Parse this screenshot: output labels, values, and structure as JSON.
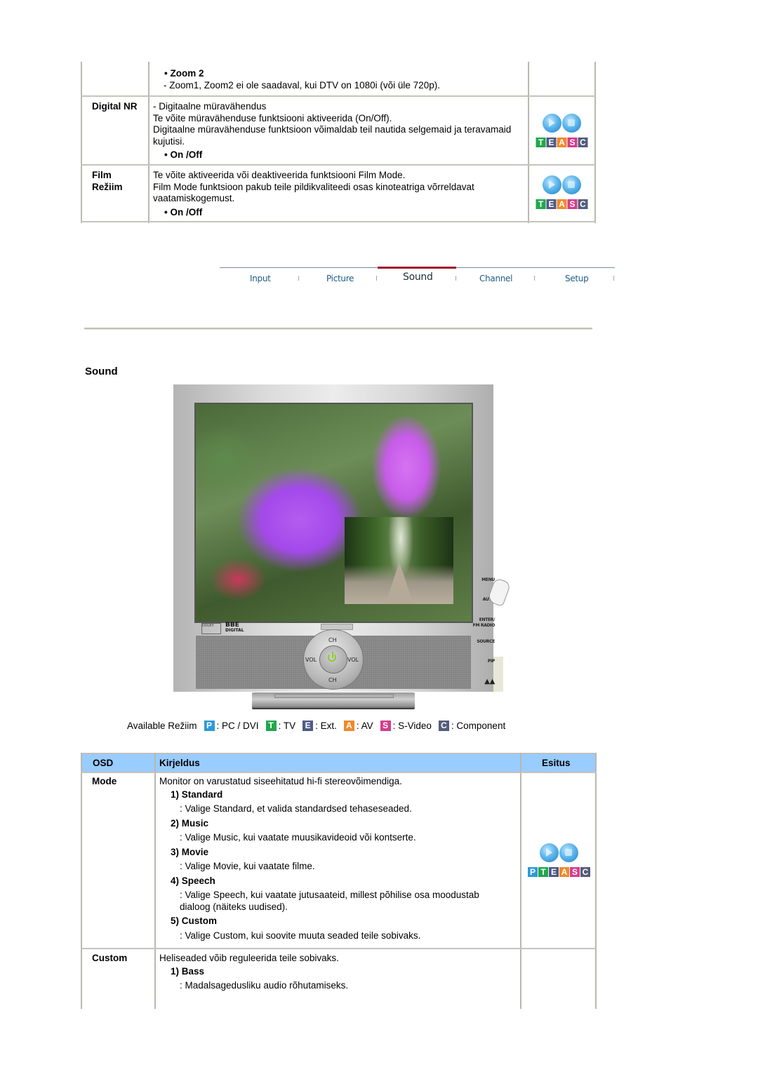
{
  "top_table": {
    "zoom_row": {
      "bullet": "• Zoom 2",
      "note": "- Zoom1, Zoom2 ei ole saadaval, kui DTV on 1080i (või üle 720p)."
    },
    "rows": [
      {
        "label": "Digital NR",
        "lines": [
          "- Digitaalne müravähendus",
          "Te võite müravähenduse funktsiooni aktiveerida (On/Off).",
          "Digitaalne müravähenduse funktsioon võimaldab teil nautida selgemaid ja teravamaid kujutisi."
        ],
        "bullet": "• On /Off",
        "modes": [
          "T",
          "E",
          "A",
          "S",
          "C"
        ]
      },
      {
        "label_line1": "Film",
        "label_line2": "Režiim",
        "lines": [
          "Te võite aktiveerida või deaktiveerida funktsiooni Film Mode.",
          "Film Mode funktsioon pakub teile pildikvaliteedi osas kinoteatriga võrreldavat vaatamiskogemust."
        ],
        "bullet": "• On /Off",
        "modes": [
          "T",
          "E",
          "A",
          "S",
          "C"
        ]
      }
    ]
  },
  "nav": {
    "items": [
      "Input",
      "Picture",
      "Sound",
      "Channel",
      "Setup"
    ],
    "active": "Sound",
    "active_color": "#a0102a"
  },
  "section_title": "Sound",
  "monitor": {
    "side_buttons": [
      "MENU",
      "AUTO",
      "ENTER/",
      "FM RADIO",
      "SOURCE",
      "PIP"
    ],
    "dpad": {
      "up": "CH",
      "down": "CH",
      "left": "VOL",
      "right": "VOL",
      "left_sign": "−",
      "right_sign": "+"
    },
    "logos": {
      "bbe_top": "BBE",
      "bbe_bottom": "DIGITAL",
      "dolby": "DOLBY"
    }
  },
  "available": {
    "label": "Available Režiim",
    "modes": [
      {
        "letter": "P",
        "text": ": PC / DVI",
        "color": "#2f9ad6"
      },
      {
        "letter": "T",
        "text": ": TV",
        "color": "#22a74e"
      },
      {
        "letter": "E",
        "text": ": Ext.",
        "color": "#4f5a86"
      },
      {
        "letter": "A",
        "text": ": AV",
        "color": "#f08a2c"
      },
      {
        "letter": "S",
        "text": ": S-Video",
        "color": "#d63d8c"
      },
      {
        "letter": "C",
        "text": ": Component",
        "color": "#555c7c"
      }
    ]
  },
  "sound_table": {
    "header": {
      "osd": "OSD",
      "desc": "Kirjeldus",
      "esitus": "Esitus",
      "bg": "#99ccff"
    },
    "mode_row": {
      "label": "Mode",
      "intro": "Monitor on varustatud siseehitatud hi-fi stereovõimendiga.",
      "items": [
        {
          "title": "1) Standard",
          "desc": ": Valige Standard, et valida standardsed tehaseseaded."
        },
        {
          "title": "2) Music",
          "desc": ": Valige Music, kui vaatate muusikavideoid või kontserte."
        },
        {
          "title": "3) Movie",
          "desc": ": Valige Movie, kui vaatate filme."
        },
        {
          "title": "4) Speech",
          "desc": ": Valige Speech, kui vaatate jutusaateid, millest põhilise osa moodustab",
          "desc2": "dialoog (näiteks uudised)."
        },
        {
          "title": "5) Custom",
          "desc": ": Valige Custom, kui soovite muuta seaded teile sobivaks."
        }
      ],
      "modes": [
        "P",
        "T",
        "E",
        "A",
        "S",
        "C"
      ]
    },
    "custom_row": {
      "label": "Custom",
      "intro": "Heliseaded võib reguleerida teile sobivaks.",
      "items": [
        {
          "title": "1) Bass",
          "desc": ": Madalsagedusliku audio rõhutamiseks."
        }
      ]
    }
  }
}
